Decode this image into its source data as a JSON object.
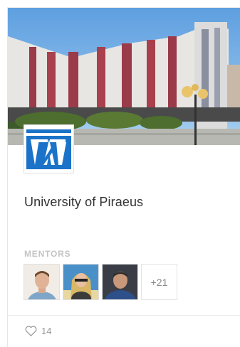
{
  "card": {
    "title": "University of Piraeus",
    "mentors_label": "MENTORS",
    "mentors_more": "+21",
    "likes": "14"
  },
  "icons": {
    "logo": "university-of-piraeus-logo",
    "like": "heart-outline-icon"
  },
  "colors": {
    "logo_blue": "#1a73c8",
    "sky": "#7ab6e8",
    "muted_text": "#c4c4c4"
  }
}
